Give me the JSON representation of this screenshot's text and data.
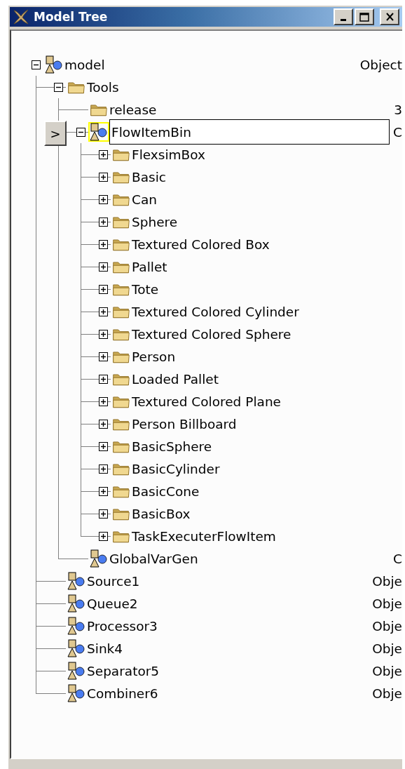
{
  "window": {
    "title": "Model Tree"
  },
  "side_button": {
    "label": ">"
  },
  "tree": [
    {
      "label": "model",
      "kind": "object",
      "value": "Object",
      "selected": false,
      "expanded": true,
      "children": [
        {
          "label": "Tools",
          "kind": "folder",
          "selected": false,
          "expanded": true,
          "children": [
            {
              "label": "release",
              "kind": "folder",
              "value": "3",
              "selected": false
            },
            {
              "label": "FlowItemBin",
              "kind": "object",
              "value": "C",
              "selected": true,
              "expanded": true,
              "children": [
                {
                  "label": "FlexsimBox",
                  "kind": "folder",
                  "selected": false,
                  "expanded": false
                },
                {
                  "label": "Basic",
                  "kind": "folder",
                  "selected": false,
                  "expanded": false
                },
                {
                  "label": "Can",
                  "kind": "folder",
                  "selected": false,
                  "expanded": false
                },
                {
                  "label": "Sphere",
                  "kind": "folder",
                  "selected": false,
                  "expanded": false
                },
                {
                  "label": "Textured Colored Box",
                  "kind": "folder",
                  "selected": false,
                  "expanded": false
                },
                {
                  "label": "Pallet",
                  "kind": "folder",
                  "selected": false,
                  "expanded": false
                },
                {
                  "label": "Tote",
                  "kind": "folder",
                  "selected": false,
                  "expanded": false
                },
                {
                  "label": "Textured Colored Cylinder",
                  "kind": "folder",
                  "selected": false,
                  "expanded": false
                },
                {
                  "label": "Textured Colored Sphere",
                  "kind": "folder",
                  "selected": false,
                  "expanded": false
                },
                {
                  "label": "Person",
                  "kind": "folder",
                  "selected": false,
                  "expanded": false
                },
                {
                  "label": "Loaded Pallet",
                  "kind": "folder",
                  "selected": false,
                  "expanded": false
                },
                {
                  "label": "Textured Colored Plane",
                  "kind": "folder",
                  "selected": false,
                  "expanded": false
                },
                {
                  "label": "Person Billboard",
                  "kind": "folder",
                  "selected": false,
                  "expanded": false
                },
                {
                  "label": "BasicSphere",
                  "kind": "folder",
                  "selected": false,
                  "expanded": false
                },
                {
                  "label": "BasicCylinder",
                  "kind": "folder",
                  "selected": false,
                  "expanded": false
                },
                {
                  "label": "BasicCone",
                  "kind": "folder",
                  "selected": false,
                  "expanded": false
                },
                {
                  "label": "BasicBox",
                  "kind": "folder",
                  "selected": false,
                  "expanded": false
                },
                {
                  "label": "TaskExecuterFlowItem",
                  "kind": "folder",
                  "selected": false,
                  "expanded": false
                }
              ]
            },
            {
              "label": "GlobalVarGen",
              "kind": "object",
              "value": "C",
              "selected": false
            }
          ]
        },
        {
          "label": "Source1",
          "kind": "object",
          "value": "Obje",
          "selected": false
        },
        {
          "label": "Queue2",
          "kind": "object",
          "value": "Obje",
          "selected": false
        },
        {
          "label": "Processor3",
          "kind": "object",
          "value": "Obje",
          "selected": false
        },
        {
          "label": "Sink4",
          "kind": "object",
          "value": "Obje",
          "selected": false
        },
        {
          "label": "Separator5",
          "kind": "object",
          "value": "Obje",
          "selected": false
        },
        {
          "label": "Combiner6",
          "kind": "object",
          "value": "Obje",
          "selected": false
        }
      ]
    }
  ]
}
